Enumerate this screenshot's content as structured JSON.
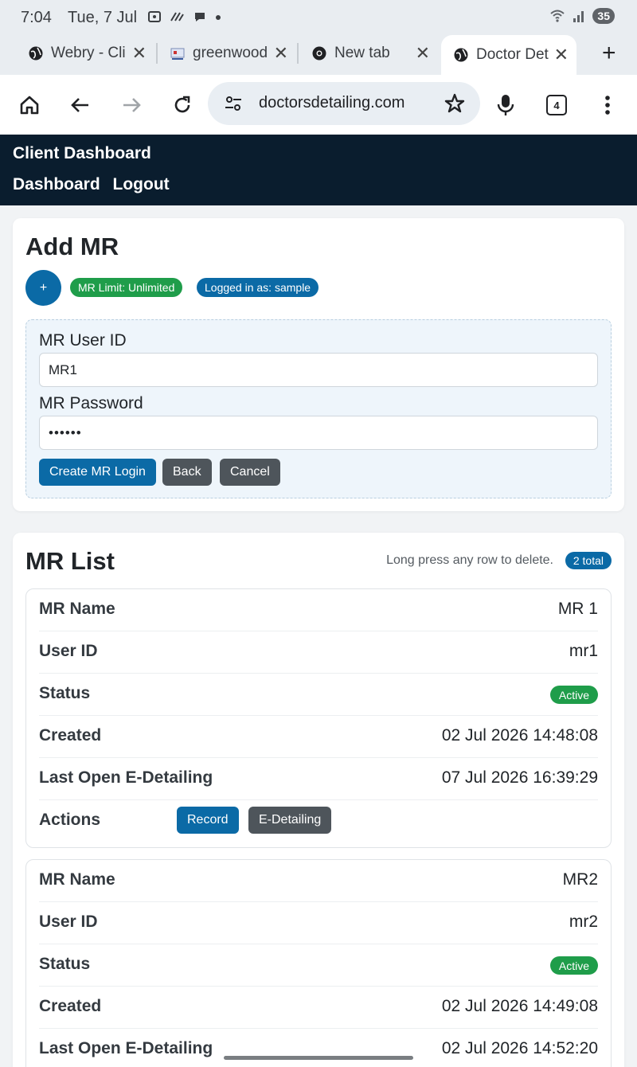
{
  "status_bar": {
    "time": "7:04",
    "date": "Tue, 7 Jul",
    "battery": "35"
  },
  "tabs": [
    {
      "title": "Webry - Cli"
    },
    {
      "title": "greenwood"
    },
    {
      "title": "New tab"
    },
    {
      "title": "Doctor Det"
    }
  ],
  "toolbar": {
    "url": "doctorsdetailing.com",
    "tab_count": "4"
  },
  "site": {
    "title": "Client Dashboard",
    "nav": [
      "Dashboard",
      "Logout"
    ]
  },
  "add_mr": {
    "heading": "Add MR",
    "plus_label": "+",
    "limit_badge": "MR Limit: Unlimited",
    "logged_badge": "Logged in as: sample",
    "user_id_label": "MR User ID",
    "user_id_value": "MR1",
    "password_label": "MR Password",
    "password_value": "••••••",
    "buttons": {
      "create": "Create MR Login",
      "back": "Back",
      "cancel": "Cancel"
    }
  },
  "mr_list": {
    "heading": "MR List",
    "hint": "Long press any row to delete.",
    "total": "2 total",
    "field_labels": {
      "name": "MR Name",
      "user_id": "User ID",
      "status": "Status",
      "created": "Created",
      "last_open": "Last Open E-Detailing",
      "actions": "Actions"
    },
    "action_buttons": {
      "record": "Record",
      "edetailing": "E-Detailing"
    },
    "items": [
      {
        "name": "MR 1",
        "user_id": "mr1",
        "status": "Active",
        "created": "02 Jul 2026 14:48:08",
        "last_open": "07 Jul 2026 16:39:29"
      },
      {
        "name": "MR2",
        "user_id": "mr2",
        "status": "Active",
        "created": "02 Jul 2026 14:49:08",
        "last_open": "02 Jul 2026 14:52:20"
      }
    ]
  }
}
